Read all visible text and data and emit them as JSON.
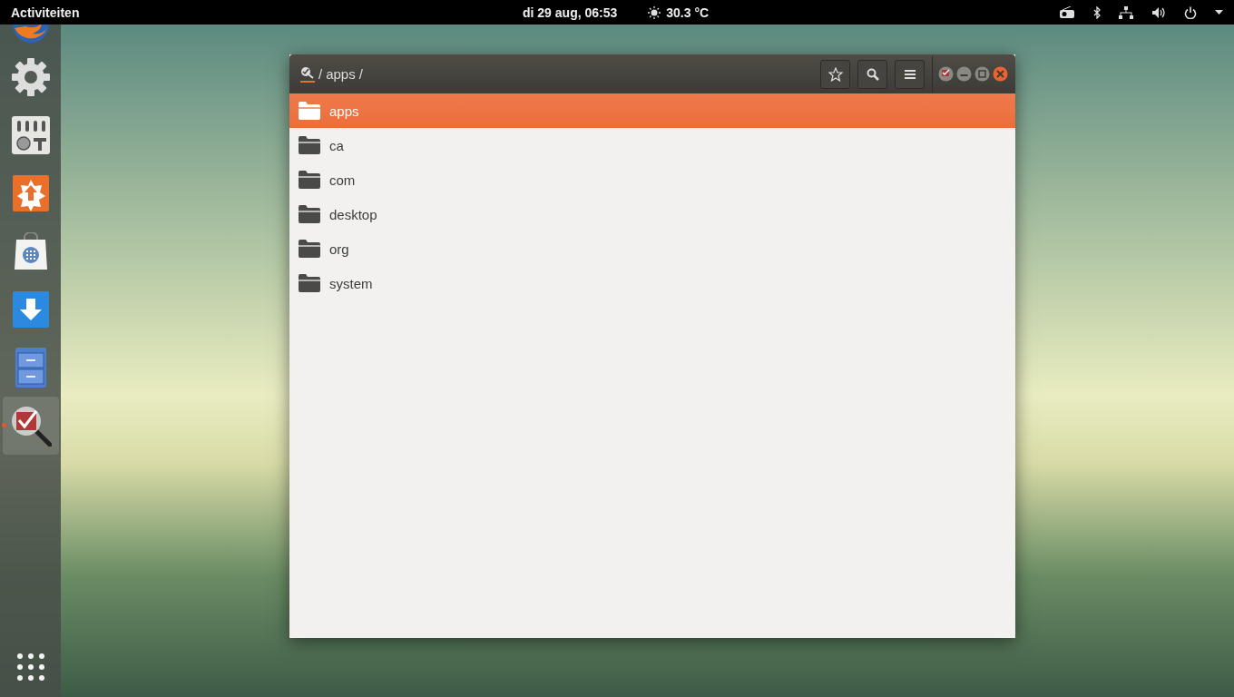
{
  "top_bar": {
    "activities": "Activiteiten",
    "clock": "di 29 aug, 06:53",
    "weather": "30.3 °C",
    "indicators": [
      {
        "kind": "radio"
      },
      {
        "kind": "bluetooth"
      },
      {
        "kind": "network"
      },
      {
        "kind": "volume"
      },
      {
        "kind": "power"
      }
    ]
  },
  "dock": {
    "items": [
      {
        "kind": "browser",
        "selected": false
      },
      {
        "kind": "settings",
        "selected": false
      },
      {
        "kind": "mixer",
        "selected": false
      },
      {
        "kind": "updater",
        "selected": false
      },
      {
        "kind": "store",
        "selected": false
      },
      {
        "kind": "download",
        "selected": false
      },
      {
        "kind": "cabinet",
        "selected": false
      },
      {
        "kind": "inspector",
        "selected": true
      }
    ]
  },
  "window": {
    "path": [
      "/",
      "apps",
      "/"
    ],
    "folders": [
      {
        "name": "apps",
        "selected": true
      },
      {
        "name": "ca",
        "selected": false
      },
      {
        "name": "com",
        "selected": false
      },
      {
        "name": "desktop",
        "selected": false
      },
      {
        "name": "org",
        "selected": false
      },
      {
        "name": "system",
        "selected": false
      }
    ]
  }
}
